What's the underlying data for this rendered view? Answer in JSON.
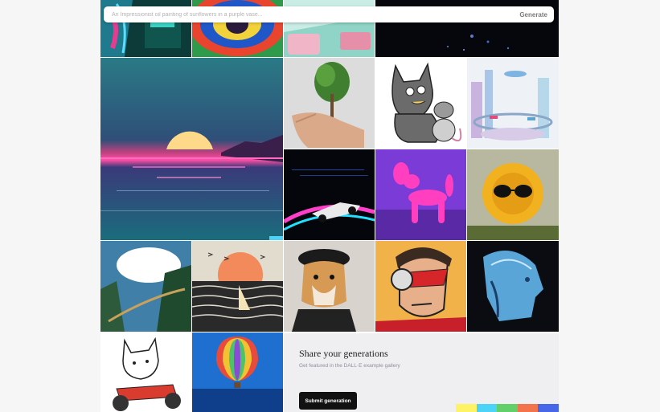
{
  "search": {
    "placeholder": "An Impressionist oil painting of sunflowers in a purple vase...",
    "generate_label": "Generate"
  },
  "share": {
    "title": "Share your generations",
    "subtitle": "Get featured in the DALL·E example gallery",
    "button_label": "Submit generation"
  },
  "palette": [
    "#fef265",
    "#4bd4f7",
    "#62d06a",
    "#f3744c",
    "#4866e8"
  ]
}
